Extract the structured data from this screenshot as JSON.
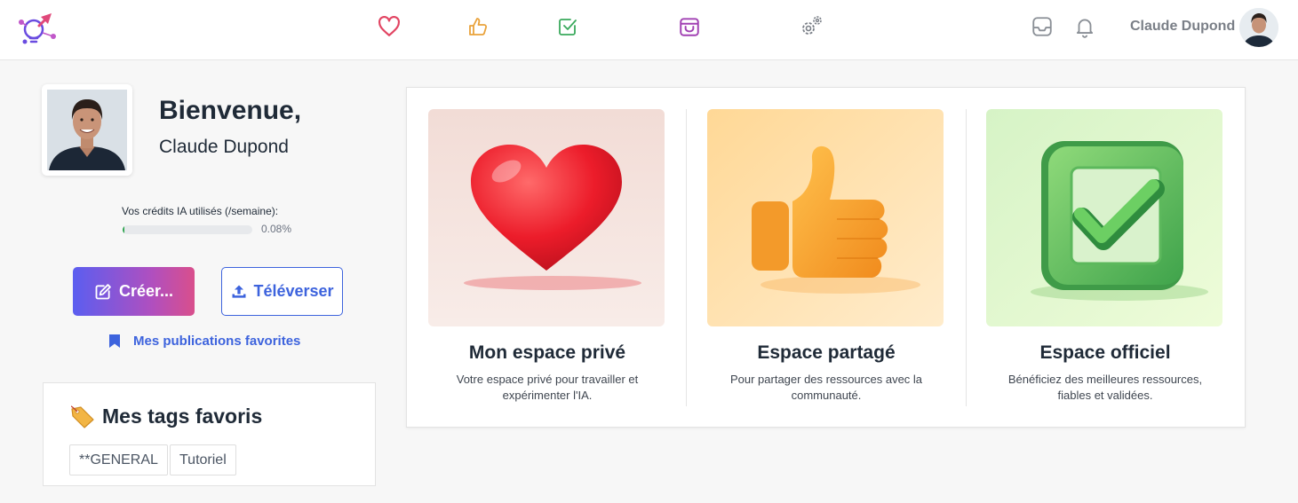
{
  "topbar": {
    "nav_icons": [
      "heart-icon",
      "thumbs-up-icon",
      "check-square-icon",
      "archive-box-icon",
      "gears-icon"
    ],
    "username": "Claude Dupond",
    "colors": {
      "heart": "#e24563",
      "thumb": "#e9a23b",
      "check": "#3aa95c",
      "box": "#a141b3",
      "gear": "#7a7f87"
    }
  },
  "profile": {
    "welcome": "Bienvenue,",
    "name": "Claude Dupond",
    "credits_label": "Vos crédits IA utilisés (/semaine):",
    "credits_percent_text": "0.08%",
    "credits_fraction": 0.0008
  },
  "actions": {
    "create_label": "Créer...",
    "upload_label": "Téléverser",
    "favorites_link": "Mes publications favorites"
  },
  "tags": {
    "title": "Mes tags favoris",
    "items": [
      "**GENERAL",
      "Tutoriel"
    ]
  },
  "spaces": [
    {
      "title": "Mon espace privé",
      "desc": "Votre espace privé pour travailler et expérimenter l'IA."
    },
    {
      "title": "Espace partagé",
      "desc": "Pour partager des ressources avec la communauté."
    },
    {
      "title": "Espace officiel",
      "desc": "Bénéficiez des meilleures ressources, fiables et validées."
    }
  ]
}
